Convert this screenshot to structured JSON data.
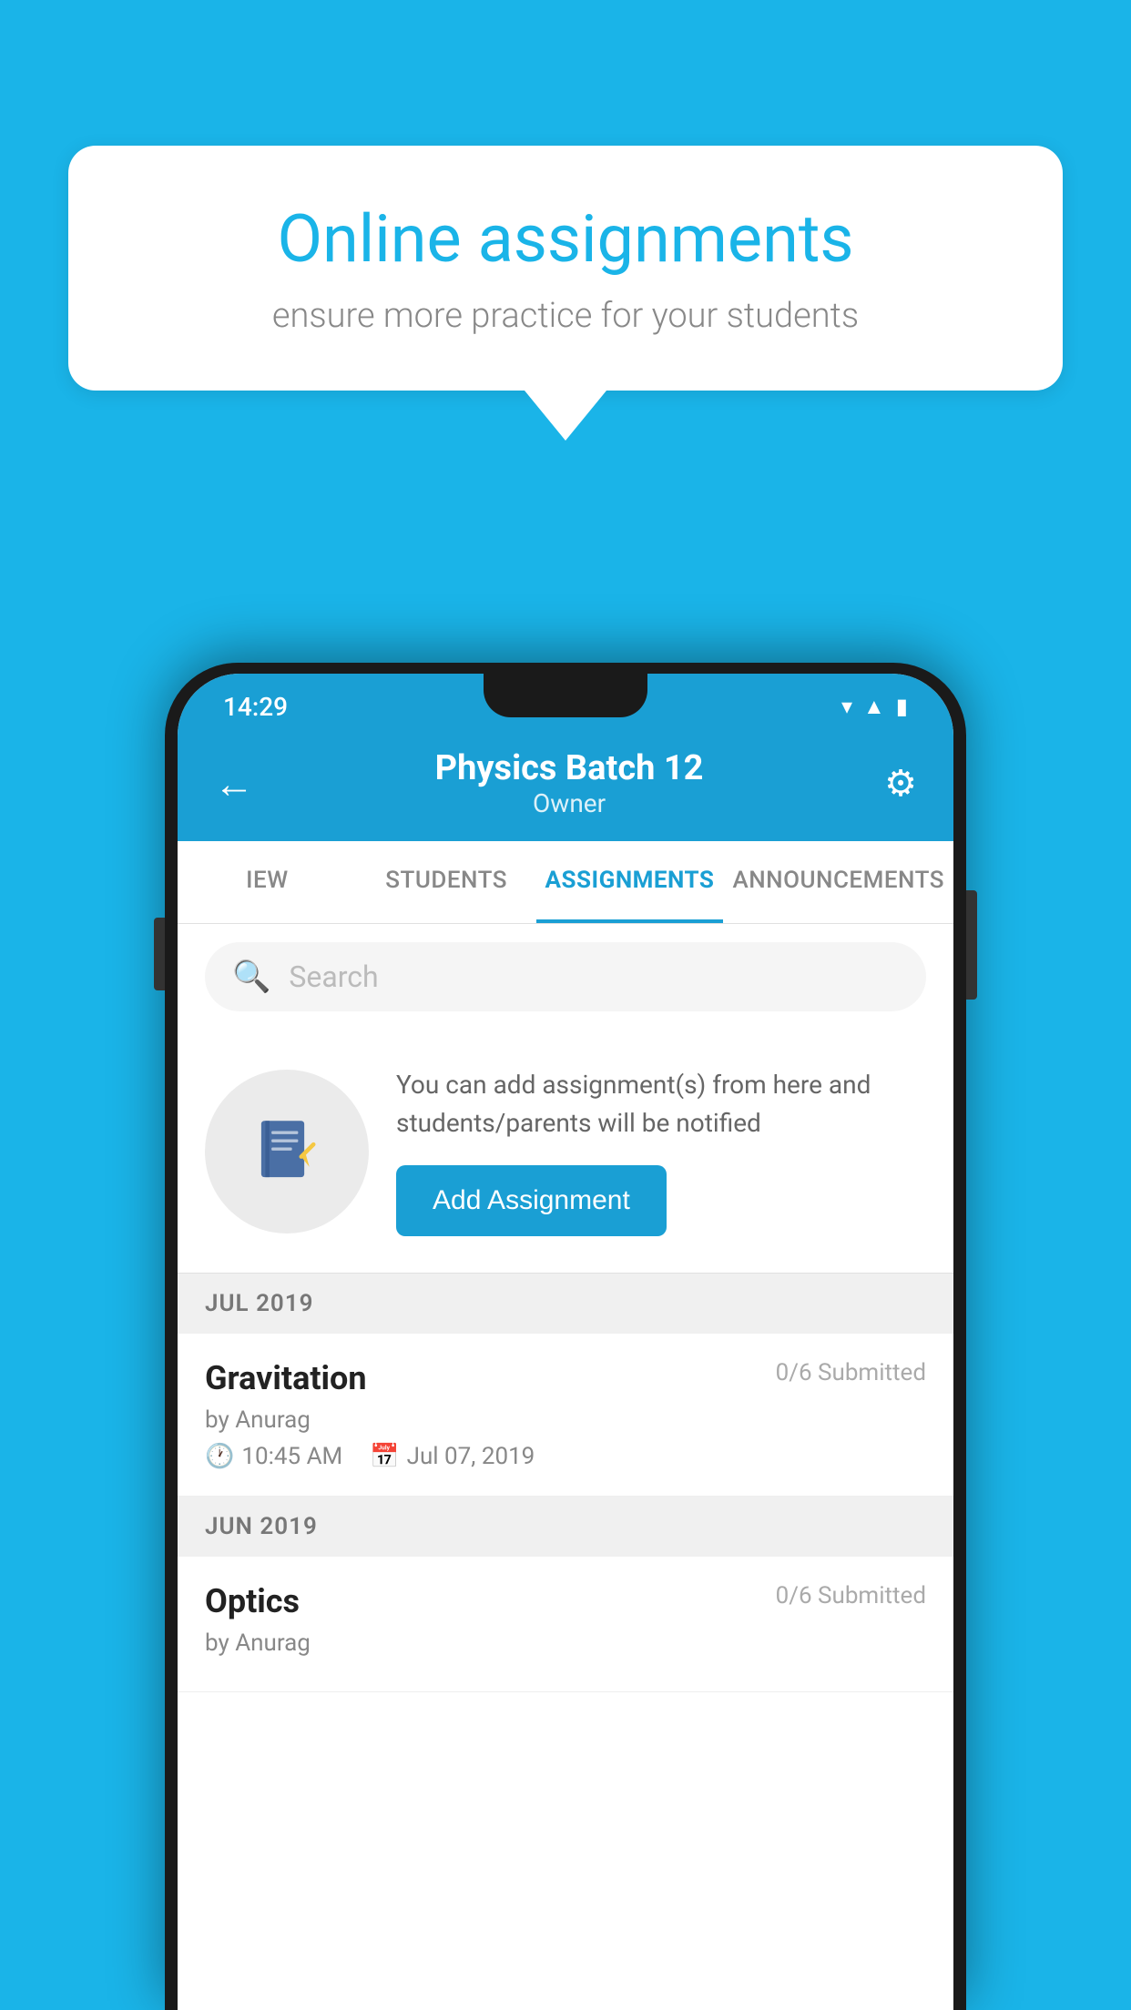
{
  "background_color": "#1ab4e8",
  "hero": {
    "title": "Online assignments",
    "subtitle": "ensure more practice for your students"
  },
  "phone": {
    "status_bar": {
      "time": "14:29",
      "wifi": "▾",
      "signal": "▲",
      "battery": "▮"
    },
    "header": {
      "title": "Physics Batch 12",
      "subtitle": "Owner",
      "back_label": "←",
      "settings_label": "⚙"
    },
    "tabs": [
      {
        "label": "IEW",
        "active": false
      },
      {
        "label": "STUDENTS",
        "active": false
      },
      {
        "label": "ASSIGNMENTS",
        "active": true
      },
      {
        "label": "ANNOUNCEMENTS",
        "active": false
      }
    ],
    "search": {
      "placeholder": "Search"
    },
    "add_assignment": {
      "description": "You can add assignment(s) from here and students/parents will be notified",
      "button_label": "Add Assignment"
    },
    "sections": [
      {
        "month_label": "JUL 2019",
        "items": [
          {
            "name": "Gravitation",
            "submitted": "0/6 Submitted",
            "by": "by Anurag",
            "time": "10:45 AM",
            "date": "Jul 07, 2019"
          }
        ]
      },
      {
        "month_label": "JUN 2019",
        "items": [
          {
            "name": "Optics",
            "submitted": "0/6 Submitted",
            "by": "by Anurag",
            "time": "",
            "date": ""
          }
        ]
      }
    ]
  }
}
